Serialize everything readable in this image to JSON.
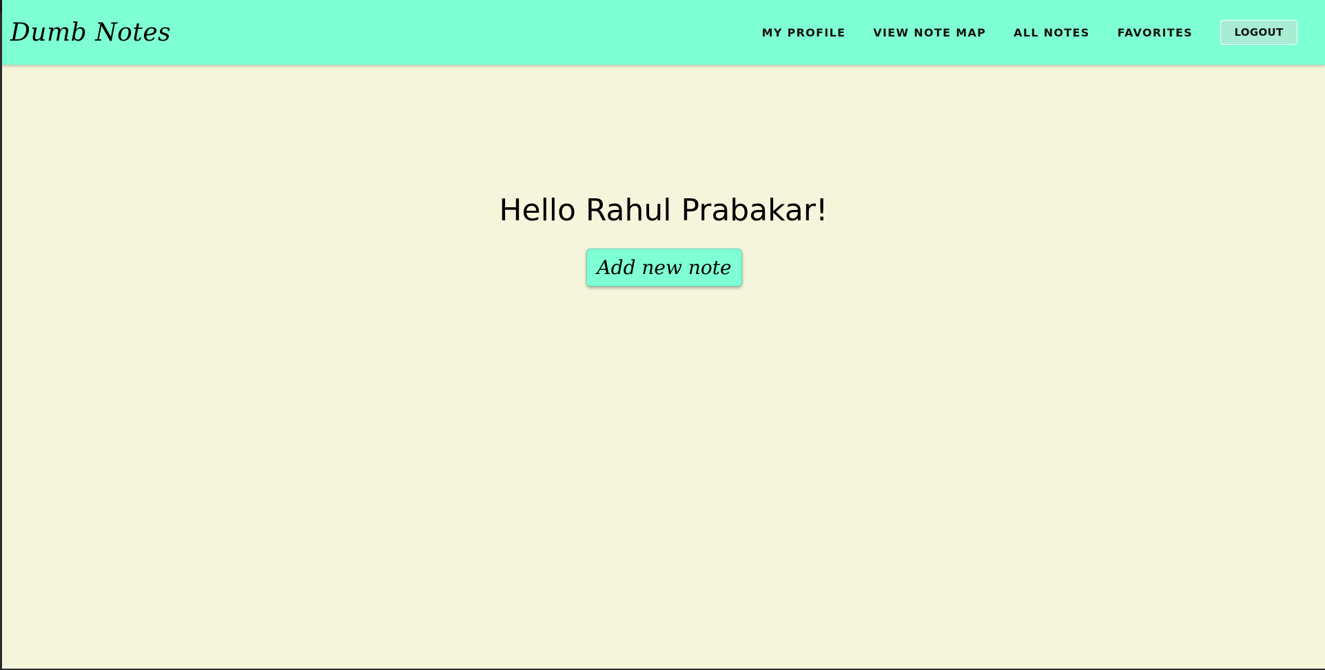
{
  "app": {
    "brand": "Dumb Notes"
  },
  "nav": {
    "items": [
      {
        "label": "MY PROFILE"
      },
      {
        "label": "VIEW NOTE MAP"
      },
      {
        "label": "ALL NOTES"
      },
      {
        "label": "FAVORITES"
      }
    ],
    "logout_label": "LOGOUT"
  },
  "main": {
    "greeting": "Hello Rahul Prabakar!",
    "add_note_label": "Add new note"
  },
  "colors": {
    "navbar_bg": "#7fffd4",
    "page_bg": "#f5f5dc",
    "button_bg": "#7fffd4"
  }
}
